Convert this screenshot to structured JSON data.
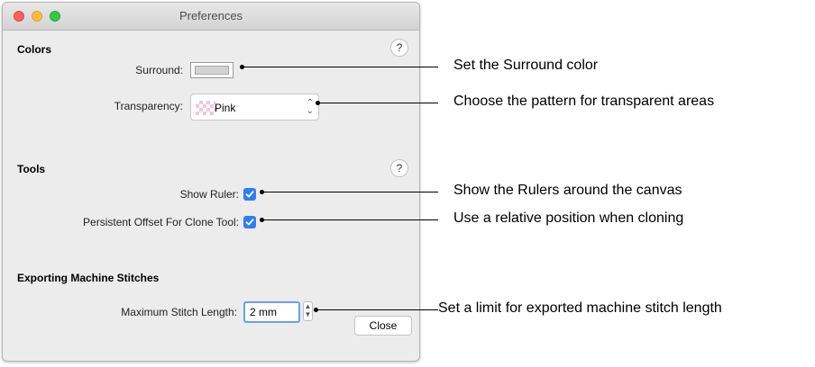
{
  "window": {
    "title": "Preferences"
  },
  "colors_section": {
    "heading": "Colors",
    "help_label": "?",
    "surround_label": "Surround:",
    "transparency_label": "Transparency:",
    "transparency_value": "Pink",
    "surround_color": "#d2d2d2"
  },
  "tools_section": {
    "heading": "Tools",
    "help_label": "?",
    "show_ruler_label": "Show Ruler:",
    "show_ruler_checked": true,
    "persistent_offset_label": "Persistent Offset For Clone Tool:",
    "persistent_offset_checked": true
  },
  "export_section": {
    "heading": "Exporting Machine Stitches",
    "max_stitch_label": "Maximum Stitch Length:",
    "max_stitch_value": "2 mm"
  },
  "buttons": {
    "close": "Close"
  },
  "icons": {
    "popup_chevron": "chevron-up-down-icon",
    "stepper": "stepper-icon",
    "checkmark": "checkmark-icon"
  },
  "annotations": {
    "surround": "Set the Surround color",
    "transparency": "Choose the pattern for transparent areas",
    "rulers": "Show the Rulers around the canvas",
    "clone": "Use a relative position when cloning",
    "stitch": "Set a limit for exported machine stitch length"
  },
  "colors": {
    "accent": "#2f7df6",
    "focus_ring": "#6aa0ef",
    "window_bg": "#ececec"
  }
}
